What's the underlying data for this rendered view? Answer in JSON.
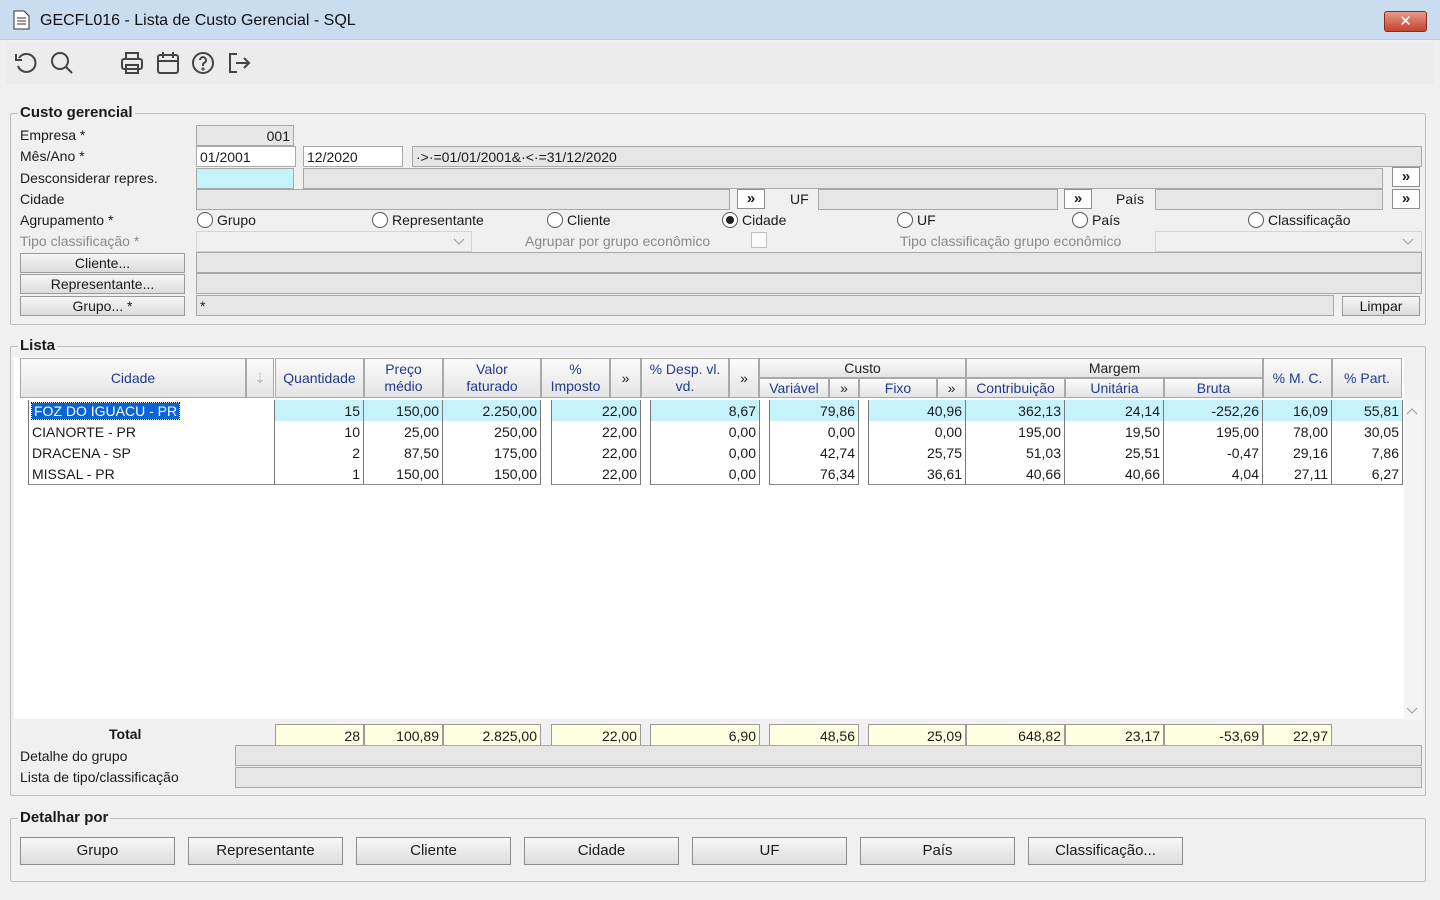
{
  "window": {
    "title": "GECFL016 - Lista de Custo Gerencial - SQL",
    "close": "✕"
  },
  "toolbar": {
    "icons": [
      "refresh-icon",
      "search-icon",
      "print-icon",
      "calendar-icon",
      "help-icon",
      "exit-icon"
    ]
  },
  "custo": {
    "legend": "Custo gerencial",
    "empresa_label": "Empresa *",
    "empresa_value": "001",
    "mesano_label": "Mês/Ano *",
    "mes_inicio": "01/2001",
    "mes_fim": "12/2020",
    "periodo_expr": "·>·=01/01/2001&·<·=31/12/2020",
    "desconsiderar_label": "Desconsiderar repres.",
    "cidade_label": "Cidade",
    "uf_label": "UF",
    "pais_label": "País",
    "more": "»",
    "agrupamento_label": "Agrupamento *",
    "agrupamento_options": [
      "Grupo",
      "Representante",
      "Cliente",
      "Cidade",
      "UF",
      "País",
      "Classificação"
    ],
    "agrupamento_selected": "Cidade",
    "tipo_class_label": "Tipo classificação *",
    "agrupar_label": "Agrupar por grupo econômico",
    "tipo_class_grupo_label": "Tipo classificação grupo econômico",
    "cliente_btn": "Cliente...",
    "representante_btn": "Representante...",
    "grupo_btn": "Grupo... *",
    "grupo_value": "*",
    "limpar": "Limpar"
  },
  "lista": {
    "legend": "Lista",
    "headers": {
      "cidade": "Cidade",
      "quantidade": "Quantidade",
      "preco1": "Preço",
      "preco2": "médio",
      "valor1": "Valor",
      "valor2": "faturado",
      "imp1": "%",
      "imp2": "Imposto",
      "desp1": "% Desp. vl.",
      "desp2": "vd.",
      "custo": "Custo",
      "variavel": "Variável",
      "fixo": "Fixo",
      "margem": "Margem",
      "contribuicao": "Contribuição",
      "unitaria": "Unitária",
      "bruta": "Bruta",
      "mc": "% M. C.",
      "part": "% Part."
    },
    "rows": [
      [
        "FOZ DO IGUACU - PR",
        "15",
        "150,00",
        "2.250,00",
        "22,00",
        "8,67",
        "79,86",
        "40,96",
        "362,13",
        "24,14",
        "-252,26",
        "16,09",
        "55,81"
      ],
      [
        "CIANORTE - PR",
        "10",
        "25,00",
        "250,00",
        "22,00",
        "0,00",
        "0,00",
        "0,00",
        "195,00",
        "19,50",
        "195,00",
        "78,00",
        "30,05"
      ],
      [
        "DRACENA - SP",
        "2",
        "87,50",
        "175,00",
        "22,00",
        "0,00",
        "42,74",
        "25,75",
        "51,03",
        "25,51",
        "-0,47",
        "29,16",
        "7,86"
      ],
      [
        "MISSAL - PR",
        "1",
        "150,00",
        "150,00",
        "22,00",
        "0,00",
        "76,34",
        "36,61",
        "40,66",
        "40,66",
        "4,04",
        "27,11",
        "6,27"
      ]
    ],
    "total_label": "Total",
    "totals": [
      "28",
      "100,89",
      "2.825,00",
      "22,00",
      "6,90",
      "48,56",
      "25,09",
      "648,82",
      "23,17",
      "-53,69",
      "22,97"
    ],
    "detalhe_grupo_label": "Detalhe do grupo",
    "lista_tipo_label": "Lista de tipo/classificação"
  },
  "detalhar": {
    "legend": "Detalhar por",
    "buttons": [
      "Grupo",
      "Representante",
      "Cliente",
      "Cidade",
      "UF",
      "País",
      "Classificação..."
    ]
  }
}
